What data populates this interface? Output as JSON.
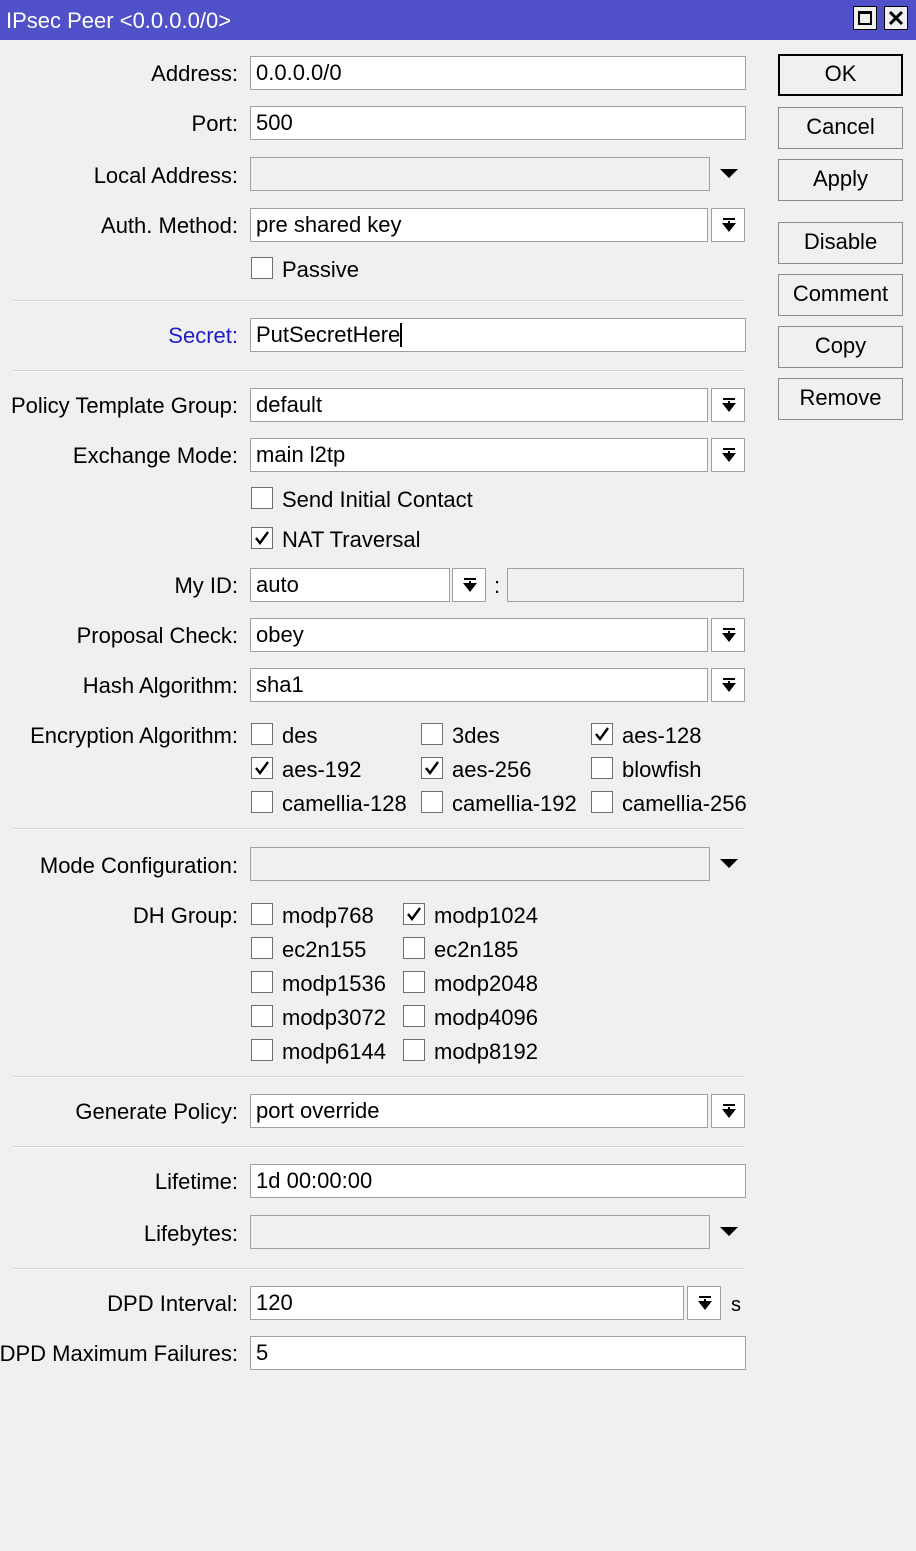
{
  "window": {
    "title": "IPsec Peer <0.0.0.0/0>"
  },
  "buttons": {
    "ok": "OK",
    "cancel": "Cancel",
    "apply": "Apply",
    "disable": "Disable",
    "comment": "Comment",
    "copy": "Copy",
    "remove": "Remove"
  },
  "fields": {
    "address": {
      "label": "Address:",
      "value": "0.0.0.0/0"
    },
    "port": {
      "label": "Port:",
      "value": "500"
    },
    "local_address": {
      "label": "Local Address:",
      "value": ""
    },
    "auth_method": {
      "label": "Auth. Method:",
      "value": "pre shared key"
    },
    "passive": {
      "label": "Passive",
      "checked": false
    },
    "secret": {
      "label": "Secret:",
      "value": "PutSecretHere"
    },
    "policy_template_group": {
      "label": "Policy Template Group:",
      "value": "default"
    },
    "exchange_mode": {
      "label": "Exchange Mode:",
      "value": "main l2tp"
    },
    "send_initial_contact": {
      "label": "Send Initial Contact",
      "checked": false
    },
    "nat_traversal": {
      "label": "NAT Traversal",
      "checked": true
    },
    "my_id": {
      "label": "My ID:",
      "value": "auto",
      "separator": ":",
      "value2": ""
    },
    "proposal_check": {
      "label": "Proposal Check:",
      "value": "obey"
    },
    "hash_algorithm": {
      "label": "Hash Algorithm:",
      "value": "sha1"
    },
    "encryption_algorithm": {
      "label": "Encryption Algorithm:",
      "options": [
        {
          "name": "des",
          "checked": false
        },
        {
          "name": "3des",
          "checked": false
        },
        {
          "name": "aes-128",
          "checked": true
        },
        {
          "name": "aes-192",
          "checked": true
        },
        {
          "name": "aes-256",
          "checked": true
        },
        {
          "name": "blowfish",
          "checked": false
        },
        {
          "name": "camellia-128",
          "checked": false
        },
        {
          "name": "camellia-192",
          "checked": false
        },
        {
          "name": "camellia-256",
          "checked": false
        }
      ]
    },
    "mode_configuration": {
      "label": "Mode Configuration:",
      "value": ""
    },
    "dh_group": {
      "label": "DH Group:",
      "options": [
        {
          "name": "modp768",
          "checked": false
        },
        {
          "name": "modp1024",
          "checked": true
        },
        {
          "name": "ec2n155",
          "checked": false
        },
        {
          "name": "ec2n185",
          "checked": false
        },
        {
          "name": "modp1536",
          "checked": false
        },
        {
          "name": "modp2048",
          "checked": false
        },
        {
          "name": "modp3072",
          "checked": false
        },
        {
          "name": "modp4096",
          "checked": false
        },
        {
          "name": "modp6144",
          "checked": false
        },
        {
          "name": "modp8192",
          "checked": false
        }
      ]
    },
    "generate_policy": {
      "label": "Generate Policy:",
      "value": "port override"
    },
    "lifetime": {
      "label": "Lifetime:",
      "value": "1d 00:00:00"
    },
    "lifebytes": {
      "label": "Lifebytes:",
      "value": ""
    },
    "dpd_interval": {
      "label": "DPD Interval:",
      "value": "120",
      "unit": "s"
    },
    "dpd_max_failures": {
      "label": "DPD Maximum Failures:",
      "value": "5"
    }
  }
}
